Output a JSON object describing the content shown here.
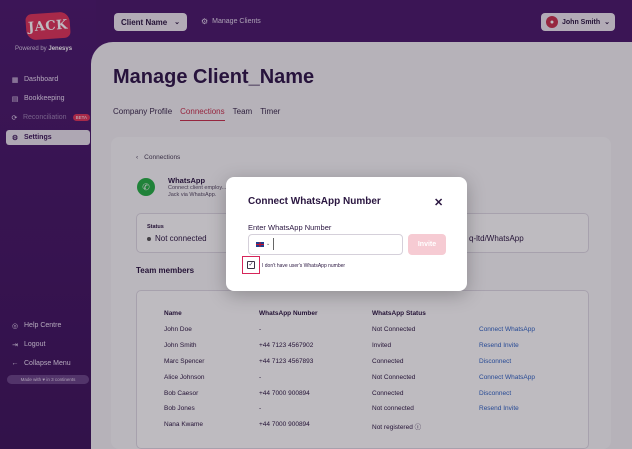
{
  "sidebar": {
    "logo_text": "JACK",
    "powered_prefix": "Powered by",
    "powered_brand": "Jenesys",
    "items": [
      {
        "label": "Dashboard",
        "icon": "dashboard-icon"
      },
      {
        "label": "Bookkeeping",
        "icon": "bookkeeping-icon"
      },
      {
        "label": "Reconciliation",
        "icon": "reconciliation-icon",
        "badge": "BETA"
      },
      {
        "label": "Settings",
        "icon": "gear-icon"
      }
    ],
    "bottom_items": [
      {
        "label": "Help Centre",
        "icon": "help-icon"
      },
      {
        "label": "Logout",
        "icon": "logout-icon"
      },
      {
        "label": "Collapse Menu",
        "icon": "collapse-icon"
      }
    ],
    "made_with": "Made with ♥ in 3 continents"
  },
  "header": {
    "client_select": "Client Name",
    "manage_clients": "Manage Clients",
    "user_name": "John Smith"
  },
  "main": {
    "title": "Manage Client_Name",
    "tabs": [
      {
        "label": "Company Profile"
      },
      {
        "label": "Connections"
      },
      {
        "label": "Team"
      },
      {
        "label": "Timer"
      }
    ],
    "breadcrumb": "Connections",
    "whatsapp": {
      "title": "WhatsApp",
      "description": "Connect client employ... Jack via WhatsApp.",
      "status_label": "Status",
      "status_value": "Not connected",
      "link_value": "q-ltd/WhatsApp"
    },
    "team_title": "Team members",
    "table": {
      "headers": [
        "Name",
        "WhatsApp Number",
        "WhatsApp Status"
      ],
      "rows": [
        {
          "name": "John Doe",
          "number": "-",
          "status": "Not Connected",
          "action": "Connect WhatsApp"
        },
        {
          "name": "John Smith",
          "number": "+44 7123 4567902",
          "status": "Invited",
          "action": "Resend Invite"
        },
        {
          "name": "Marc Spencer",
          "number": "+44 7123 4567893",
          "status": "Connected",
          "action": "Disconnect"
        },
        {
          "name": "Alice Johnson",
          "number": "-",
          "status": "Not Connected",
          "action": "Connect WhatsApp"
        },
        {
          "name": "Bob Caesor",
          "number": "+44 7000 900894",
          "status": "Connected",
          "action": "Disconnect"
        },
        {
          "name": "Bob Jones",
          "number": "-",
          "status": "Not connected",
          "action": "Resend Invite"
        },
        {
          "name": "Nana Kwame",
          "number": "+44 7000 900894",
          "status": "Not registered ⓘ",
          "action": ""
        }
      ]
    }
  },
  "modal": {
    "title": "Connect WhatsApp Number",
    "field_label": "Enter WhatsApp Number",
    "phone_value": "",
    "country_flag": "uk-flag-icon",
    "invite_label": "Invite",
    "checkbox_label": "I don't have user's WhatsApp number",
    "checkbox_checked": true
  },
  "colors": {
    "brand_purple": "#4a1a6b",
    "accent_pink": "#c8314d",
    "link_blue": "#2f63c4"
  }
}
